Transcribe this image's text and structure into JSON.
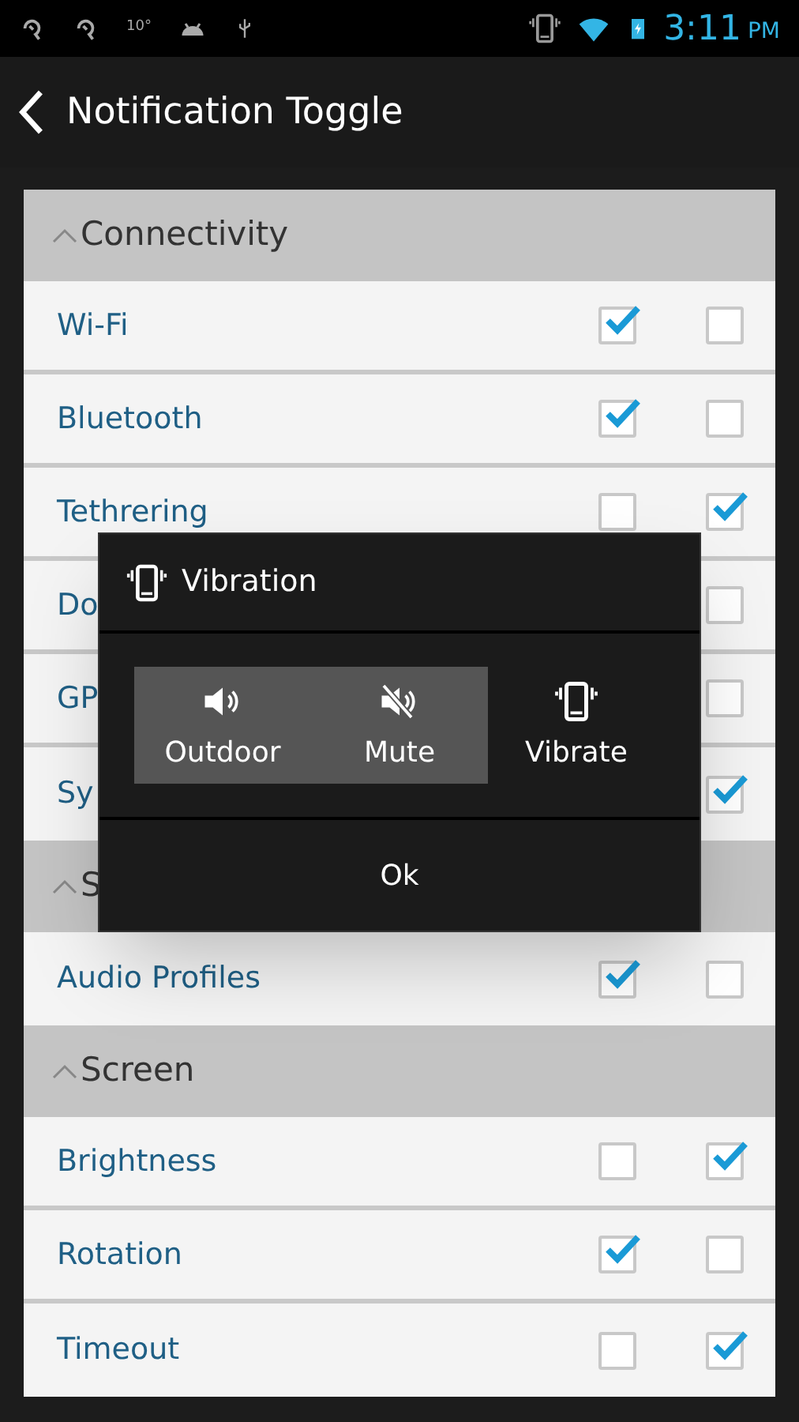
{
  "status_bar": {
    "temperature": "10°",
    "time": "3:11",
    "meridiem": "PM"
  },
  "action_bar": {
    "title": "Notification Toggle"
  },
  "sections": [
    {
      "title": "Connectivity",
      "expanded": true,
      "rows": [
        {
          "label": "Wi-Fi",
          "primary": {
            "checked": true
          },
          "secondary": {
            "checked": false
          }
        },
        {
          "label": "Bluetooth",
          "primary": {
            "checked": true
          },
          "secondary": {
            "checked": false
          }
        },
        {
          "label": "Tethrering",
          "primary": {
            "checked": false
          },
          "secondary": {
            "checked": true
          }
        },
        {
          "label": "Do",
          "secondary": {
            "checked": false
          }
        },
        {
          "label": "GP",
          "secondary": {
            "checked": false
          }
        },
        {
          "label": "Sy",
          "secondary": {
            "checked": true
          }
        }
      ]
    },
    {
      "title": "S",
      "expanded": true,
      "rows": [
        {
          "label": "Audio Profiles",
          "primary": {
            "checked": true
          },
          "secondary": {
            "checked": false
          }
        }
      ]
    },
    {
      "title": "Screen",
      "expanded": true,
      "rows": [
        {
          "label": "Brightness",
          "primary": {
            "checked": false
          },
          "secondary": {
            "checked": true
          }
        },
        {
          "label": "Rotation",
          "primary": {
            "checked": true
          },
          "secondary": {
            "checked": false
          }
        },
        {
          "label": "Timeout",
          "primary": {
            "checked": false
          },
          "secondary": {
            "checked": true
          }
        }
      ]
    }
  ],
  "dialog": {
    "title": "Vibration",
    "options": [
      {
        "kind": "speaker",
        "label": "Outdoor",
        "selected": true
      },
      {
        "kind": "mute",
        "label": "Mute",
        "selected": true
      },
      {
        "kind": "vibrate",
        "label": "Vibrate",
        "selected": false
      }
    ],
    "button": "Ok"
  }
}
